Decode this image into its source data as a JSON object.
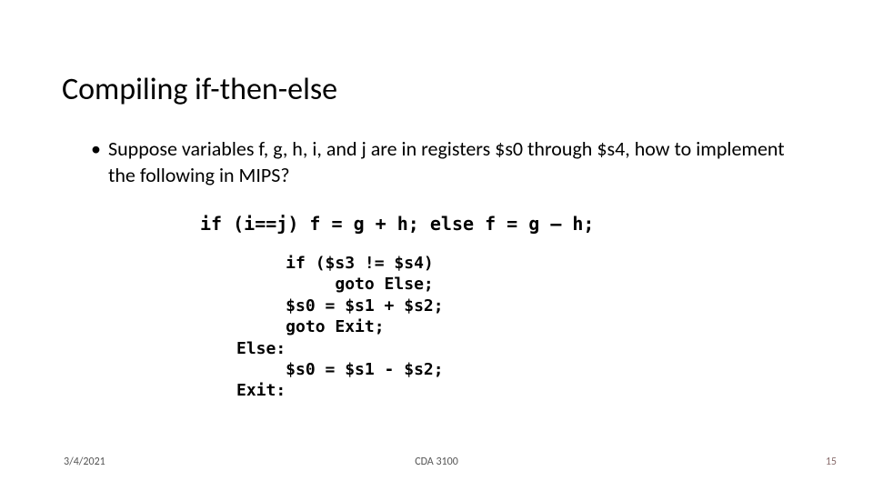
{
  "title": "Compiling if-then-else",
  "bullet": "Suppose variables f, g, h, i, and j are in registers $s0 through $s4, how to implement the following in MIPS?",
  "code_c": "if (i==j) f = g + h; else f = g – h;",
  "code_pseudo": "     if ($s3 != $s4)\n          goto Else;\n     $s0 = $s1 + $s2;\n     goto Exit;\nElse:\n     $s0 = $s1 - $s2;\nExit:",
  "footer": {
    "date": "3/4/2021",
    "course": "CDA 3100",
    "page": "15"
  }
}
